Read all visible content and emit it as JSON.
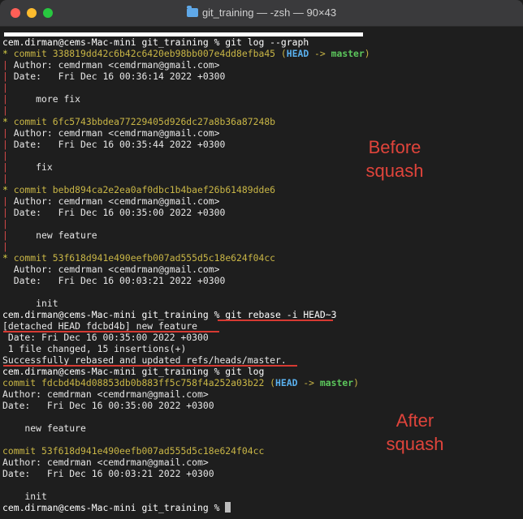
{
  "window": {
    "title": "git_training — -zsh — 90×43"
  },
  "lines": [
    {
      "segs": [
        {
          "t": "cem.dirman@cems-Mac-mini git_training % git log --graph",
          "c": "g"
        }
      ]
    },
    {
      "segs": [
        {
          "t": "* ",
          "c": "graph-y"
        },
        {
          "t": "commit 338819dd42c6b42c6420eb98bb007e4dd8efba45 ",
          "c": "hash"
        },
        {
          "t": "(",
          "c": "paren"
        },
        {
          "t": "HEAD",
          "c": "head"
        },
        {
          "t": " -> ",
          "c": "arrow"
        },
        {
          "t": "master",
          "c": "branch"
        },
        {
          "t": ")",
          "c": "paren"
        }
      ]
    },
    {
      "segs": [
        {
          "t": "| ",
          "c": "graph-r"
        },
        {
          "t": "Author: cemdrman <cemdrman@gmail.com>"
        }
      ]
    },
    {
      "segs": [
        {
          "t": "| ",
          "c": "graph-r"
        },
        {
          "t": "Date:   Fri Dec 16 00:36:14 2022 +0300"
        }
      ]
    },
    {
      "segs": [
        {
          "t": "|",
          "c": "graph-r"
        }
      ]
    },
    {
      "segs": [
        {
          "t": "| ",
          "c": "graph-r"
        },
        {
          "t": "    more fix"
        }
      ]
    },
    {
      "segs": [
        {
          "t": "|",
          "c": "graph-r"
        }
      ]
    },
    {
      "segs": [
        {
          "t": "* ",
          "c": "graph-y"
        },
        {
          "t": "commit 6fc5743bbdea77229405d926dc27a8b36a87248b",
          "c": "hash"
        }
      ]
    },
    {
      "segs": [
        {
          "t": "| ",
          "c": "graph-r"
        },
        {
          "t": "Author: cemdrman <cemdrman@gmail.com>"
        }
      ]
    },
    {
      "segs": [
        {
          "t": "| ",
          "c": "graph-r"
        },
        {
          "t": "Date:   Fri Dec 16 00:35:44 2022 +0300"
        }
      ]
    },
    {
      "segs": [
        {
          "t": "|",
          "c": "graph-r"
        }
      ]
    },
    {
      "segs": [
        {
          "t": "| ",
          "c": "graph-r"
        },
        {
          "t": "    fix"
        }
      ]
    },
    {
      "segs": [
        {
          "t": "|",
          "c": "graph-r"
        }
      ]
    },
    {
      "segs": [
        {
          "t": "* ",
          "c": "graph-y"
        },
        {
          "t": "commit bebd894ca2e2ea0af0dbc1b4baef26b61489dde6",
          "c": "hash"
        }
      ]
    },
    {
      "segs": [
        {
          "t": "| ",
          "c": "graph-r"
        },
        {
          "t": "Author: cemdrman <cemdrman@gmail.com>"
        }
      ]
    },
    {
      "segs": [
        {
          "t": "| ",
          "c": "graph-r"
        },
        {
          "t": "Date:   Fri Dec 16 00:35:00 2022 +0300"
        }
      ]
    },
    {
      "segs": [
        {
          "t": "|",
          "c": "graph-r"
        }
      ]
    },
    {
      "segs": [
        {
          "t": "| ",
          "c": "graph-r"
        },
        {
          "t": "    new feature"
        }
      ]
    },
    {
      "segs": [
        {
          "t": "|",
          "c": "graph-r"
        }
      ]
    },
    {
      "segs": [
        {
          "t": "* ",
          "c": "graph-y"
        },
        {
          "t": "commit 53f618d941e490eefb007ad555d5c18e624f04cc",
          "c": "hash"
        }
      ]
    },
    {
      "segs": [
        {
          "t": "  Author: cemdrman <cemdrman@gmail.com>"
        }
      ]
    },
    {
      "segs": [
        {
          "t": "  Date:   Fri Dec 16 00:03:21 2022 +0300"
        }
      ]
    },
    {
      "segs": []
    },
    {
      "segs": [
        {
          "t": "      init"
        }
      ]
    },
    {
      "segs": [
        {
          "t": "cem.dirman@cems-Mac-mini git_training % git rebase -i HEAD~3",
          "c": "g"
        }
      ]
    },
    {
      "segs": [
        {
          "t": "[detached HEAD fdcbd4b] new feature"
        }
      ]
    },
    {
      "segs": [
        {
          "t": " Date: Fri Dec 16 00:35:00 2022 +0300"
        }
      ]
    },
    {
      "segs": [
        {
          "t": " 1 file changed, 15 insertions(+)"
        }
      ]
    },
    {
      "segs": [
        {
          "t": "Successfully rebased and updated refs/heads/master."
        }
      ]
    },
    {
      "segs": [
        {
          "t": "cem.dirman@cems-Mac-mini git_training % git log",
          "c": "g"
        }
      ]
    },
    {
      "segs": [
        {
          "t": "commit fdcbd4b4d08853db0b883ff5c758f4a252a03b22 ",
          "c": "hash"
        },
        {
          "t": "(",
          "c": "paren"
        },
        {
          "t": "HEAD",
          "c": "head"
        },
        {
          "t": " -> ",
          "c": "arrow"
        },
        {
          "t": "master",
          "c": "branch"
        },
        {
          "t": ")",
          "c": "paren"
        }
      ]
    },
    {
      "segs": [
        {
          "t": "Author: cemdrman <cemdrman@gmail.com>"
        }
      ]
    },
    {
      "segs": [
        {
          "t": "Date:   Fri Dec 16 00:35:00 2022 +0300"
        }
      ]
    },
    {
      "segs": []
    },
    {
      "segs": [
        {
          "t": "    new feature"
        }
      ]
    },
    {
      "segs": []
    },
    {
      "segs": [
        {
          "t": "commit 53f618d941e490eefb007ad555d5c18e624f04cc",
          "c": "hash"
        }
      ]
    },
    {
      "segs": [
        {
          "t": "Author: cemdrman <cemdrman@gmail.com>"
        }
      ]
    },
    {
      "segs": [
        {
          "t": "Date:   Fri Dec 16 00:03:21 2022 +0300"
        }
      ]
    },
    {
      "segs": []
    },
    {
      "segs": [
        {
          "t": "    init"
        }
      ]
    },
    {
      "segs": [
        {
          "t": "cem.dirman@cems-Mac-mini git_training % ",
          "c": "g"
        }
      ],
      "cursor": true
    }
  ],
  "annotations": {
    "before": [
      "Before",
      "squash"
    ],
    "after": [
      "After",
      "squash"
    ],
    "accent_color": "#e0443b"
  },
  "colors": {
    "hash": "#c9b646",
    "head": "#5ab1ef",
    "branch": "#5cc75c",
    "graph": "#d94b4b"
  }
}
